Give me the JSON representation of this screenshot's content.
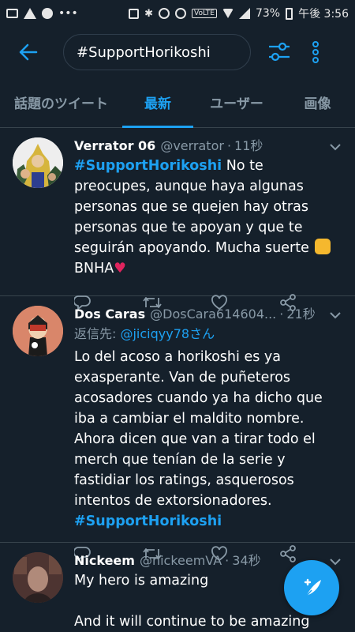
{
  "status_bar": {
    "battery": "73%",
    "time": "午後 3:56",
    "carrier_badge": "VoLTE"
  },
  "search": {
    "query": "#SupportHorikoshi"
  },
  "tabs": [
    {
      "label": "話題のツイート",
      "active": false
    },
    {
      "label": "最新",
      "active": true
    },
    {
      "label": "ユーザー",
      "active": false
    },
    {
      "label": "画像",
      "active": false
    }
  ],
  "tweets": [
    {
      "name": "Verrator 06",
      "handle": "@verrator",
      "dot": "·",
      "time": "11秒",
      "hashtag": "#SupportHorikoshi",
      "text": "No te preocupes, aunque haya algunas personas que se quejen hay otras personas que te apoyan y que te seguirán apoyando. Mucha suerte",
      "suffix": "BNHA",
      "heart": "♥"
    },
    {
      "name": "Dos Caras",
      "handle": "@DosCara614604...",
      "dot": "·",
      "time": "21秒",
      "reply_prefix": "返信先: ",
      "reply_to": "@jiciqyy78さん",
      "text": "Lo del acoso a horikoshi es ya exasperante. Van de puñeteros acosadores cuando ya ha dicho que iba a cambiar el maldito nombre. Ahora dicen que van a tirar todo el merch que tenían de la serie y fastidiar los ratings, asquerosos intentos de extorsionadores.",
      "hashtag": "#SupportHorikoshi"
    },
    {
      "name": "Nickeem",
      "handle": "@nickeemVA",
      "dot": "·",
      "time": "34秒",
      "line1": "My hero is amazing",
      "line2": "And it will continue to be amazing"
    }
  ],
  "colors": {
    "background": "#15202b",
    "accent": "#1da1f2",
    "secondary_text": "#8899a6",
    "divider": "#38444d",
    "heart": "#e0245e"
  }
}
